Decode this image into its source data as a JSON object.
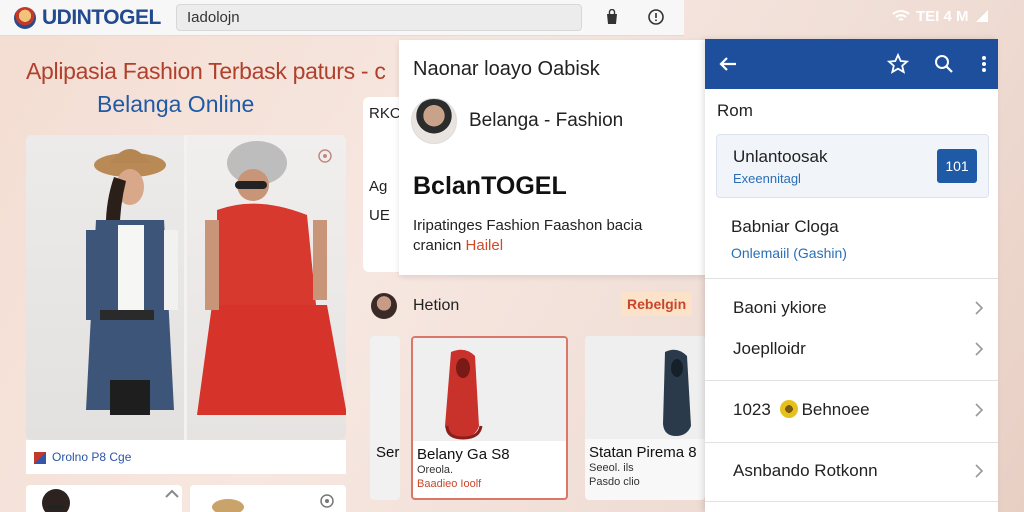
{
  "browser": {
    "logo_text": "UDINTOGEL",
    "search_value": "Iadolojn"
  },
  "status_bar": {
    "text": "TEI 4 M"
  },
  "hero": {
    "title": "Aplipasia Fashion Terbask paturs - c",
    "subtitle": "Belanga Online",
    "caption": "Orolno P8 Cge"
  },
  "mid_back": {
    "lines": [
      "RKO",
      "Ag",
      "UE"
    ]
  },
  "mid_panel": {
    "header": "Naonar loayo Oabisk",
    "profile_name": "Belanga - Fashion",
    "brand_title": "BclanTOGEL",
    "brand_desc": "Iripatinges Fashion Faashon bacia",
    "brand_desc_2": "cranicn",
    "brand_desc_accent": "Hailel"
  },
  "fashion_row": {
    "label": "Hetion",
    "tag": "Rebelgin"
  },
  "products": [
    {
      "name": "Ser",
      "sub": "",
      "price": ""
    },
    {
      "name": "Belany Ga S8",
      "sub": "Oreola.",
      "price": "Baadieo Ioolf"
    },
    {
      "name": "Statan Pirema 8",
      "sub": "Seeol. ils",
      "price": "Pasdo clio"
    }
  ],
  "phone": {
    "section_title": "Rom",
    "feature_title": "Unlantoosak",
    "feature_sub": "Exeennitagl",
    "feature_count": "101",
    "option_title": "Babniar Cloga",
    "option_sub": "Onlemaiil (Gashin)",
    "rows": [
      "Baoni ykiore",
      "Joeplloidr"
    ],
    "trend_prefix": "1023",
    "trend_word": "Behnoee",
    "last_row": "Asnbando Rotkonn"
  },
  "colors": {
    "brand_blue": "#1d4f9c",
    "accent_red": "#c9462a"
  }
}
